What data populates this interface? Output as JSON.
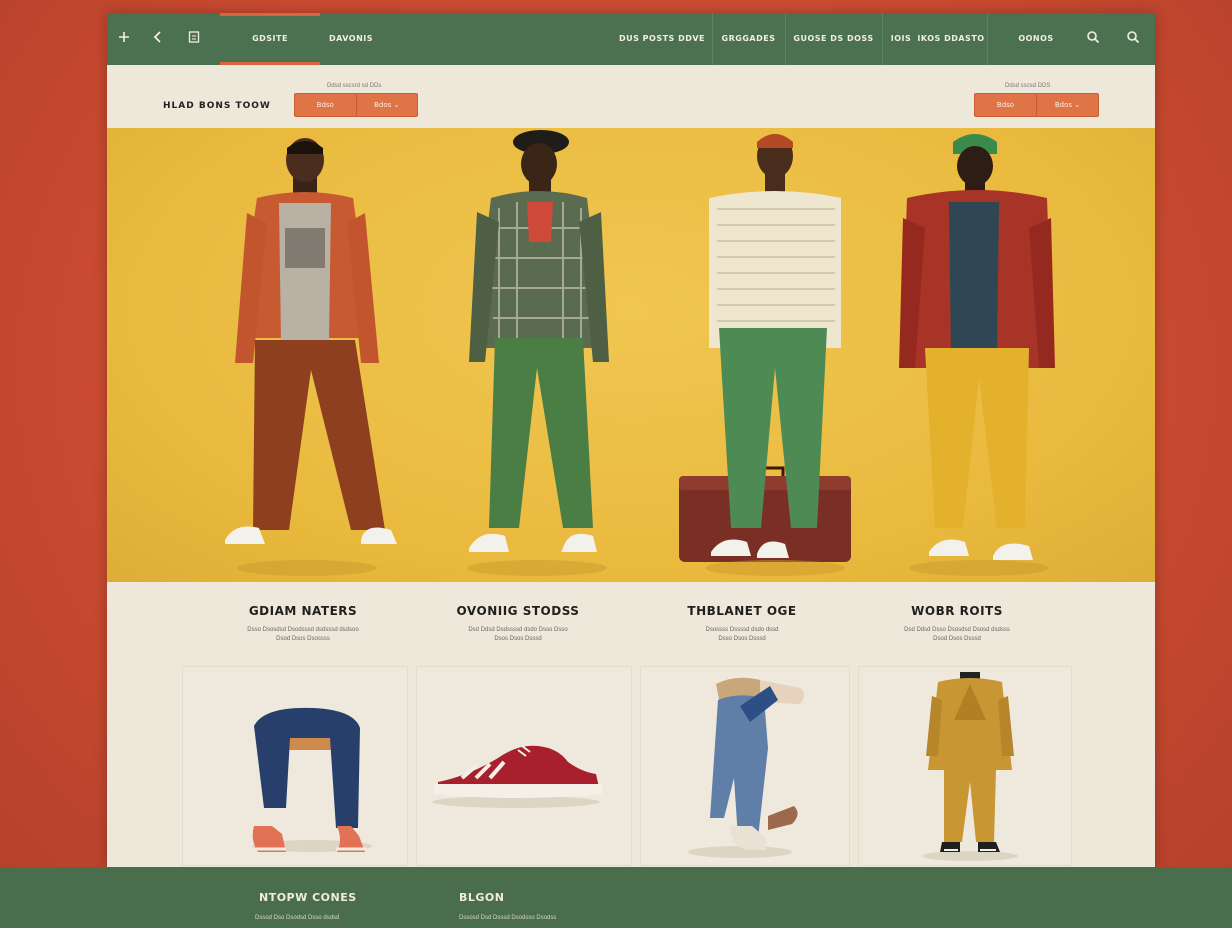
{
  "nav": {
    "icons": [
      "plus-icon",
      "back-arrow-icon",
      "bookmark-icon"
    ],
    "tabs_left": [
      "GDSITE",
      "DAVONIS"
    ],
    "tabs_right": [
      "DUS POSTS DDVE",
      "GRGGADES",
      "GUOSE DS DOSS",
      "IOIS",
      "IKOS DDASTO",
      "OONOS"
    ],
    "right_icons": [
      "search-icon",
      "search-icon"
    ],
    "accent": "#d9653f",
    "bar_color": "#4c7150"
  },
  "subbar": {
    "title": "HLAD BONS TOOW",
    "left_caption": "Ddsd sscsrd sd DDs",
    "left_buttons": [
      "Bdso",
      "Bdos ⌄"
    ],
    "right_caption": "Ddsd sscsd DDS",
    "right_buttons": [
      "Bdso",
      "Bdos ⌄"
    ]
  },
  "hero": {
    "background": "#e9b93d",
    "models": [
      "model-1",
      "model-2",
      "model-3",
      "model-4"
    ]
  },
  "categories": [
    {
      "title": "GDIAM NATERS",
      "desc1": "Dsso Dsosdsd Dsodsssd dsdsssd dsdsoo",
      "desc2": "Dsod Dsos Dsossss"
    },
    {
      "title": "OVONIIG STODSS",
      "desc1": "Dsd Ddsd Dsdssssd dsdo Dsso Dsso",
      "desc2": "Dsos Dsos Dsssd"
    },
    {
      "title": "THBLANET OGE",
      "desc1": "Dsossss Dssssd dsdo dssd",
      "desc2": "Dsso Dsos Dsssd"
    },
    {
      "title": "WOBR ROITS",
      "desc1": "Dsd Ddsd Dsso Dsosdsd Dsosd dsdsss",
      "desc2": "Dsod Dsos Dsssd"
    }
  ],
  "footer": {
    "col1_title": "NTOPW CONES",
    "col1_sub": "Dssod Dso Dsodsd Dsso dsdsd",
    "col2_title": "BLGON",
    "col2_sub": "Dssosd Dsd Dsssd Dsodsso Dsodss"
  }
}
